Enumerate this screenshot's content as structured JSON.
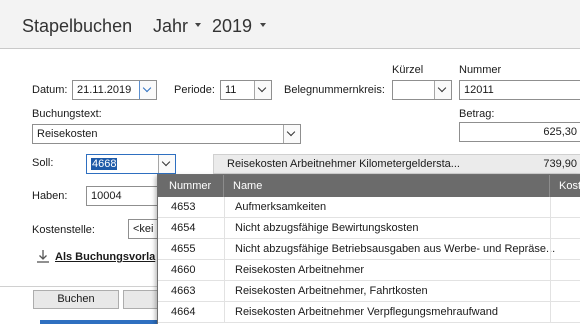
{
  "header": {
    "title": "Stapelbuchen",
    "year_label": "Jahr",
    "year_value": "2019"
  },
  "form": {
    "datum_label": "Datum:",
    "datum_value": "21.11.2019",
    "periode_label": "Periode:",
    "periode_value": "11",
    "belegnummernkreis_label": "Belegnummernkreis:",
    "kuerzel_label": "Kürzel",
    "kuerzel_value": "",
    "nummer_label": "Nummer",
    "nummer_value": "12011",
    "buchungstext_label": "Buchungstext:",
    "buchungstext_value": "Reisekosten",
    "betrag_label": "Betrag:",
    "betrag_value": "625,30",
    "soll_label": "Soll:",
    "soll_value": "4668",
    "soll_account_name": "Reisekosten Arbeitnehmer Kilometergelderstа...",
    "soll_account_amount": "739,90",
    "haben_label": "Haben:",
    "haben_value": "10004",
    "kostenstelle_label": "Kostenstelle:",
    "kostenstelle_value": "<kei",
    "vorlage_link": "Als Buchungsvorla",
    "buchen_button": "Buchen"
  },
  "grid": {
    "columns": [
      "Nummer",
      "Name",
      "Kost"
    ],
    "sort_indicator": "▲",
    "rows": [
      {
        "nummer": "4653",
        "name": "Aufmerksamkeiten"
      },
      {
        "nummer": "4654",
        "name": "Nicht abzugsfähige Bewirtungskosten"
      },
      {
        "nummer": "4655",
        "name": "Nicht abzugsfähige Betriebsausgaben aus Werbe- und Repräse..."
      },
      {
        "nummer": "4660",
        "name": "Reisekosten Arbeitnehmer"
      },
      {
        "nummer": "4663",
        "name": "Reisekosten Arbeitnehmer, Fahrtkosten"
      },
      {
        "nummer": "4664",
        "name": "Reisekosten Arbeitnehmer Verpflegungsmehraufwand"
      }
    ]
  },
  "colors": {
    "header_bg": "#f3f3f3",
    "grid_header_bg": "#6b6b6b",
    "selection": "#1e5aa8"
  }
}
